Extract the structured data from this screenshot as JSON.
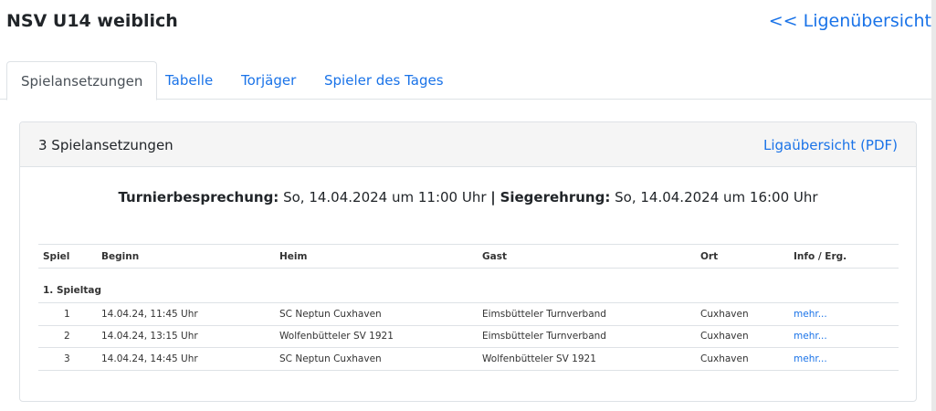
{
  "header": {
    "title": "NSV U14 weiblich",
    "back_link": "<< Ligenübersicht"
  },
  "tabs": [
    {
      "label": "Spielansetzungen",
      "active": true
    },
    {
      "label": "Tabelle",
      "active": false
    },
    {
      "label": "Torjäger",
      "active": false
    },
    {
      "label": "Spieler des Tages",
      "active": false
    }
  ],
  "card": {
    "title": "3 Spielansetzungen",
    "pdf_link": "Ligaübersicht (PDF)",
    "info": {
      "label1": "Turnierbesprechung:",
      "value1": "So, 14.04.2024 um 11:00 Uhr",
      "separator": "|",
      "label2": "Siegerehrung:",
      "value2": "So, 14.04.2024 um 16:00 Uhr"
    }
  },
  "table": {
    "headers": {
      "spiel": "Spiel",
      "beginn": "Beginn",
      "heim": "Heim",
      "gast": "Gast",
      "ort": "Ort",
      "info": "Info / Erg."
    },
    "group": "1. Spieltag",
    "rows": [
      {
        "spiel": "1",
        "beginn": "14.04.24, 11:45 Uhr",
        "heim": "SC Neptun Cuxhaven",
        "gast": "Eimsbütteler Turnverband",
        "ort": "Cuxhaven",
        "info": "mehr..."
      },
      {
        "spiel": "2",
        "beginn": "14.04.24, 13:15 Uhr",
        "heim": "Wolfenbütteler SV 1921",
        "gast": "Eimsbütteler Turnverband",
        "ort": "Cuxhaven",
        "info": "mehr..."
      },
      {
        "spiel": "3",
        "beginn": "14.04.24, 14:45 Uhr",
        "heim": "SC Neptun Cuxhaven",
        "gast": "Wolfenbütteler SV 1921",
        "ort": "Cuxhaven",
        "info": "mehr..."
      }
    ]
  },
  "colors": {
    "link": "#1a73e8",
    "header_bg": "#f5f5f5",
    "border": "#dee2e6"
  }
}
